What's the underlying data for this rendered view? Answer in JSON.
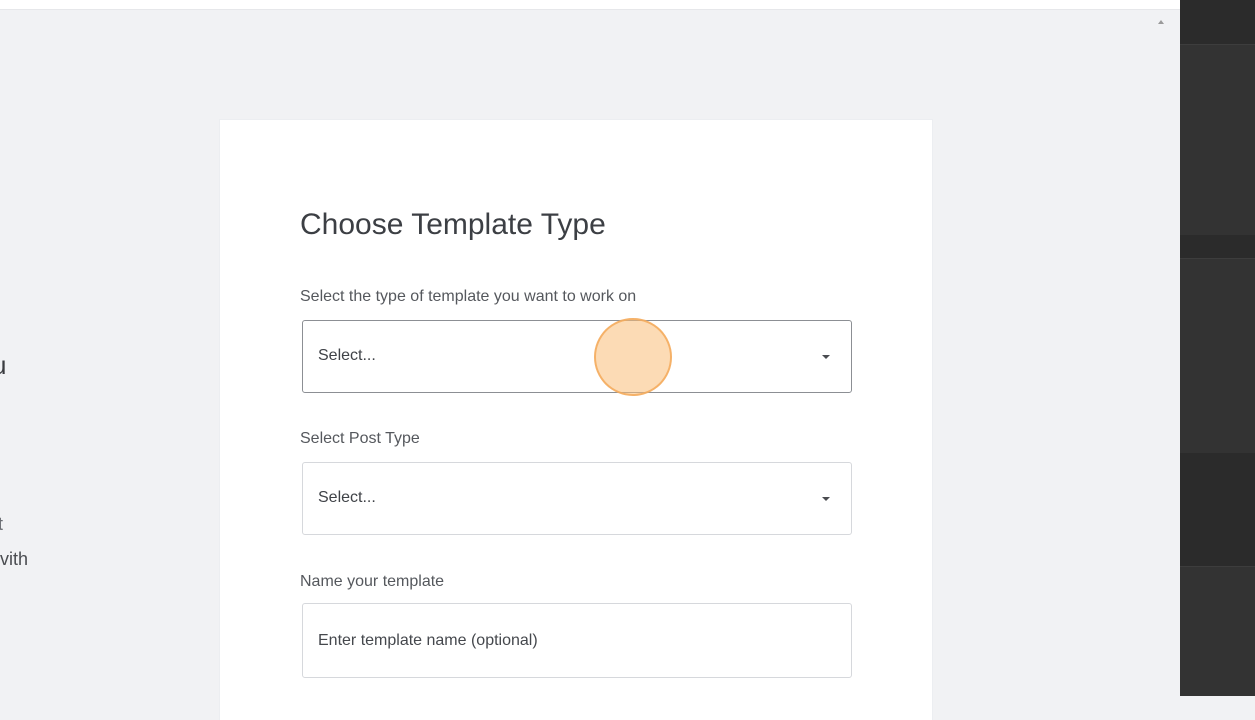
{
  "background": {
    "heading_fragment": "u",
    "line1_fragment": "t",
    "line2_fragment": "vith"
  },
  "dialog": {
    "title": "Choose Template Type",
    "template_type": {
      "label": "Select the type of template you want to work on",
      "selected_value": "Select..."
    },
    "post_type": {
      "label": "Select Post Type",
      "selected_value": "Select..."
    },
    "template_name": {
      "label": "Name your template",
      "placeholder": "Enter template name (optional)"
    }
  },
  "colors": {
    "page_bg": "#f1f2f4",
    "card_bg": "#ffffff",
    "right_panel_bg": "#2b2b2b",
    "click_marker": "#f5aa5a"
  },
  "icons": [
    "chevron-down-icon",
    "scroll-up-icon"
  ]
}
